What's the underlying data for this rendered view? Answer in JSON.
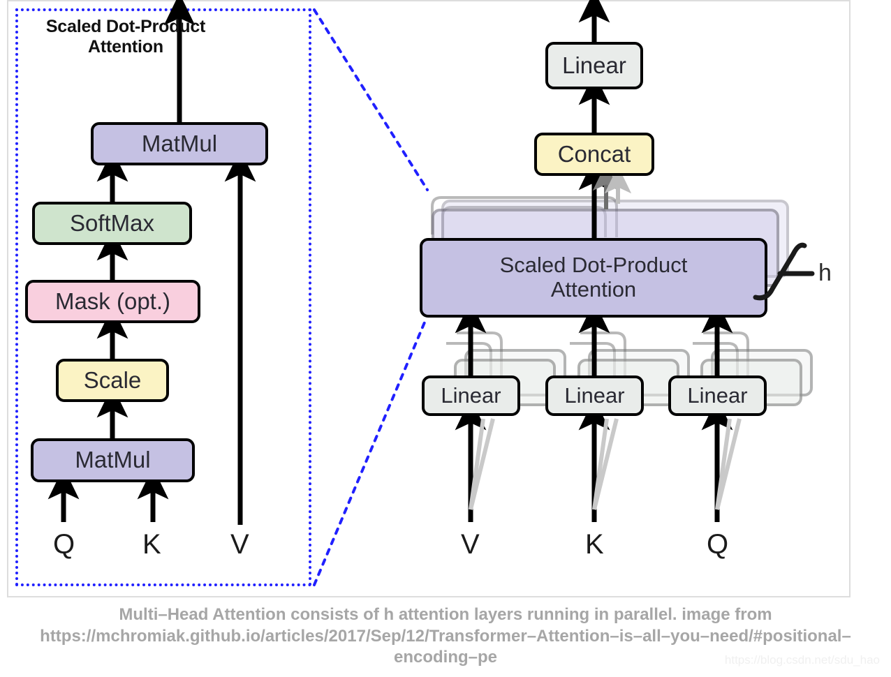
{
  "figure": {
    "caption": "Multi–Head Attention consists of h attention layers running in parallel. image from https://mchromiak.github.io/articles/2017/Sep/12/Transformer–Attention–is–all–you–need/#positional–encoding–pe",
    "watermark": "https://blog.csdn.net/sdu_hao",
    "accent_color": "#2020ff",
    "frame_color": "#dddddd"
  },
  "left_panel": {
    "title_line1": "Scaled Dot-Product",
    "title_line2": "Attention",
    "border_style": "dotted",
    "border_color": "#2020ff",
    "nodes": [
      {
        "id": "matmul-top",
        "label": "MatMul",
        "color": "#c5c1e3"
      },
      {
        "id": "softmax",
        "label": "SoftMax",
        "color": "#cfe4cd"
      },
      {
        "id": "mask",
        "label": "Mask (opt.)",
        "color": "#f9cfde"
      },
      {
        "id": "scale",
        "label": "Scale",
        "color": "#fbf3c4"
      },
      {
        "id": "matmul-bot",
        "label": "MatMul",
        "color": "#c5c1e3"
      }
    ],
    "inputs": [
      {
        "id": "q",
        "label": "Q"
      },
      {
        "id": "k",
        "label": "K"
      },
      {
        "id": "v",
        "label": "V"
      }
    ]
  },
  "right_panel": {
    "nodes": [
      {
        "id": "linear-out",
        "label": "Linear",
        "color": "#e9ecea",
        "stacked": false
      },
      {
        "id": "concat",
        "label": "Concat",
        "color": "#fbf3c4",
        "stacked": false
      },
      {
        "id": "sdpa",
        "label_line1": "Scaled Dot-Product",
        "label_line2": "Attention",
        "color": "#c5c1e3",
        "stacked": true
      },
      {
        "id": "linear-v",
        "label": "Linear",
        "color": "#e9ecea",
        "stacked": true
      },
      {
        "id": "linear-k",
        "label": "Linear",
        "color": "#e9ecea",
        "stacked": true
      },
      {
        "id": "linear-q",
        "label": "Linear",
        "color": "#e9ecea",
        "stacked": true
      }
    ],
    "heads_label": "h",
    "inputs": [
      {
        "id": "v",
        "label": "V"
      },
      {
        "id": "k",
        "label": "K"
      },
      {
        "id": "q",
        "label": "Q"
      }
    ]
  }
}
